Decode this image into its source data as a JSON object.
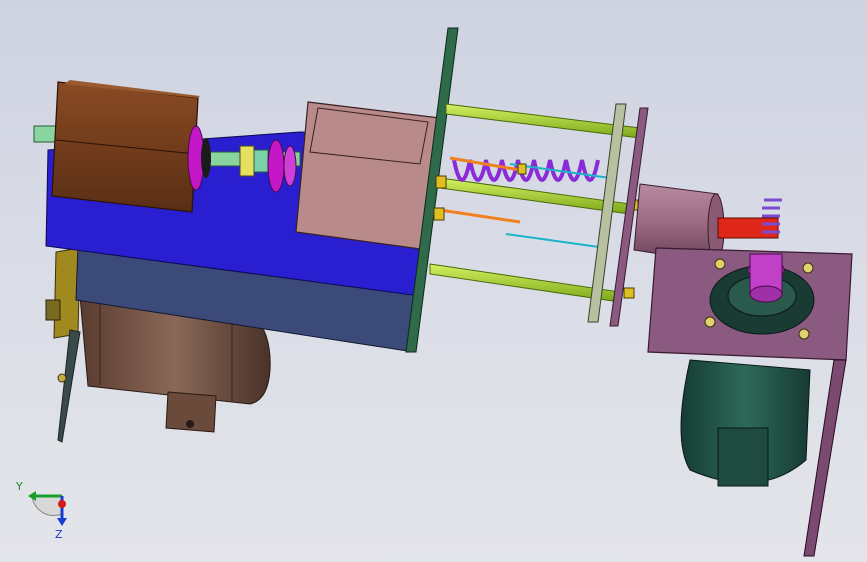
{
  "viewport": {
    "background_top": "#cfd3e1",
    "background_bottom": "#e4e5ea"
  },
  "triad": {
    "y_label": "Y",
    "z_label": "Z",
    "y_color": "#18a02c",
    "z_color": "#1a3bd0",
    "x_color": "#d81a1a"
  },
  "colors": {
    "motor_housing": "#6e3a1c",
    "base_plate": "#2a1fd0",
    "flange": "#c418c8",
    "gray_block": "#b88a8a",
    "green_plate": "#2f6b4a",
    "rod": "#9ad12a",
    "spring": "#8a2bd8",
    "cyan_spring": "#1ab4c8",
    "orange_spring": "#f08020",
    "cylinder": "#9a6a80",
    "red_shaft": "#e0281a",
    "mount_plate": "#8a5a80",
    "gear_motor": "#1f4a40",
    "gear": "#c040c8",
    "bracket": "#a08a20",
    "lower_motor": "#6a4a3a"
  }
}
